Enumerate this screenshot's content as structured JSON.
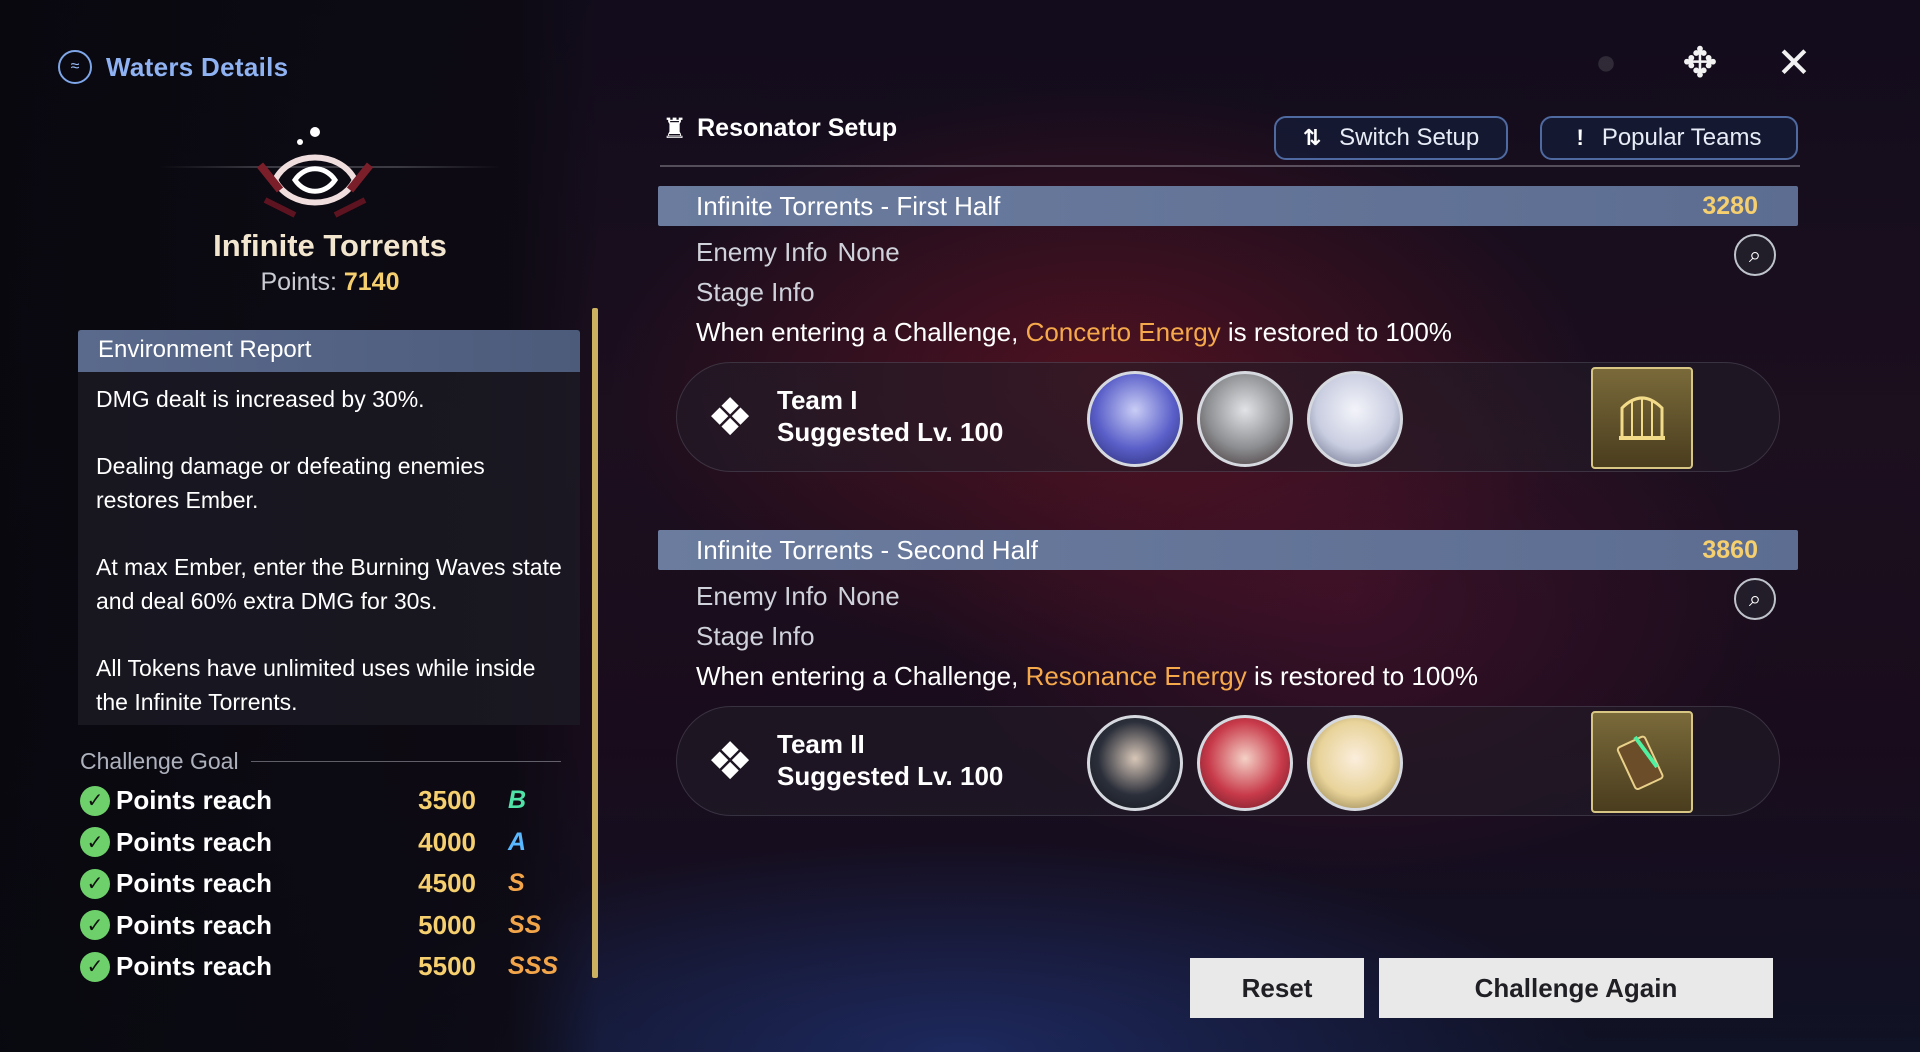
{
  "header": {
    "title": "Waters Details",
    "logo_icon": "wave-emblem-icon"
  },
  "stage": {
    "name": "Infinite Torrents",
    "points_label": "Points:",
    "points_value": "7140"
  },
  "environment": {
    "title": "Environment Report",
    "lines": [
      "DMG dealt is increased by 30%.",
      "Dealing damage or defeating enemies restores Ember.",
      "At max Ember, enter the Burning Waves state and deal 60% extra DMG for 30s.",
      "All Tokens have unlimited uses while inside the Infinite Torrents."
    ]
  },
  "challenge_goal": {
    "title": "Challenge Goal",
    "rows": [
      {
        "text": "Points reach",
        "points": "3500",
        "rank": "B",
        "rank_color": "#4fe3a8"
      },
      {
        "text": "Points reach",
        "points": "4000",
        "rank": "A",
        "rank_color": "#5ab8ff"
      },
      {
        "text": "Points reach",
        "points": "4500",
        "rank": "S",
        "rank_color": "#f3a54a"
      },
      {
        "text": "Points reach",
        "points": "5000",
        "rank": "SS",
        "rank_color": "#f3a54a"
      },
      {
        "text": "Points reach",
        "points": "5500",
        "rank": "SSS",
        "rank_color": "#f3a54a"
      }
    ]
  },
  "setup": {
    "title": "Resonator Setup",
    "switch_label": "Switch Setup",
    "popular_label": "Popular Teams"
  },
  "halves": [
    {
      "title": "Infinite Torrents - First Half",
      "score": "3280",
      "enemy_label": "Enemy Info",
      "enemy_value": "None",
      "stage_label": "Stage Info",
      "desc_pre": "When entering a Challenge,",
      "desc_hl": "Concerto Energy",
      "desc_post": "is restored to 100%",
      "team_name": "Team I",
      "team_lv": "Suggested Lv. 100",
      "avatars": [
        "#5a5fc9",
        "#8b8d90",
        "#c9cde0"
      ],
      "item_icon": "golden-cage-icon"
    },
    {
      "title": "Infinite Torrents - Second Half",
      "score": "3860",
      "enemy_label": "Enemy Info",
      "enemy_value": "None",
      "stage_label": "Stage Info",
      "desc_pre": "When entering a Challenge,",
      "desc_hl": "Resonance Energy",
      "desc_post": "is restored to 100%",
      "team_name": "Team II",
      "team_lv": "Suggested Lv. 100",
      "avatars": [
        "#2b2f3a",
        "#c83a4a",
        "#e8d39a"
      ],
      "item_icon": "green-scroll-icon"
    }
  ],
  "buttons": {
    "reset": "Reset",
    "again": "Challenge Again"
  },
  "accent": {
    "gold": "#f6cf6f",
    "orange": "#f6a94b",
    "bar": "#6b7c9f"
  }
}
